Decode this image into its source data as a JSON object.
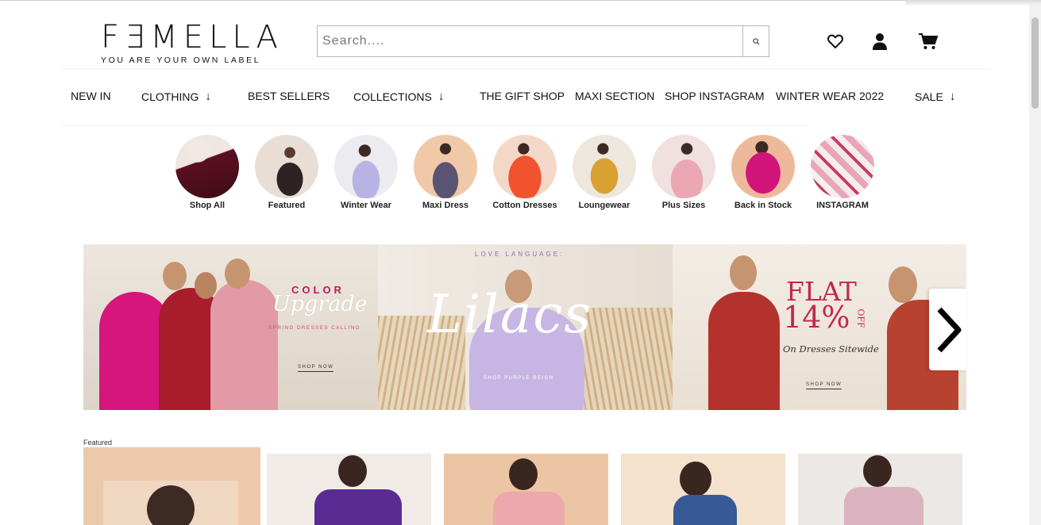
{
  "brand": {
    "name": "FƎMELLA",
    "tagline": "YOU ARE YOUR OWN LABEL"
  },
  "search": {
    "placeholder": "Search...."
  },
  "header_icons": [
    "heart-icon",
    "user-icon",
    "cart-icon"
  ],
  "nav": [
    {
      "label": "NEW IN"
    },
    {
      "label": "CLOTHING"
    },
    {
      "label": "BEST SELLERS"
    },
    {
      "label": "COLLECTIONS"
    },
    {
      "label": "THE GIFT SHOP"
    },
    {
      "label": "MAXI SECTION"
    },
    {
      "label": "SHOP INSTAGRAM"
    },
    {
      "label": "WINTER WEAR 2022"
    },
    {
      "label": "SALE"
    }
  ],
  "categories": [
    {
      "label": "Shop All"
    },
    {
      "label": "Featured"
    },
    {
      "label": "Winter Wear"
    },
    {
      "label": "Maxi Dress"
    },
    {
      "label": "Cotton Dresses"
    },
    {
      "label": "Loungewear"
    },
    {
      "label": "Plus Sizes"
    },
    {
      "label": "Back in Stock"
    },
    {
      "label": "INSTAGRAM"
    }
  ],
  "banner": {
    "slide1": {
      "title": "COLOR",
      "script": "Upgrade",
      "subtitle": "SPRING DRESSES CALLING",
      "cta": "SHOP NOW"
    },
    "slide2": {
      "kicker": "LOVE LANGUAGE:",
      "script": "Lilacs",
      "cta": "SHOP PURPLE REIGN"
    },
    "slide3": {
      "title": "FLAT",
      "percent": "14%",
      "off": "OFF",
      "subtitle": "On Dresses Sitewide",
      "cta": "SHOP NOW"
    }
  },
  "featured": {
    "label": "Featured"
  },
  "colors": {
    "accent_pink": "#c2185b",
    "banner_red": "#b3322d"
  }
}
